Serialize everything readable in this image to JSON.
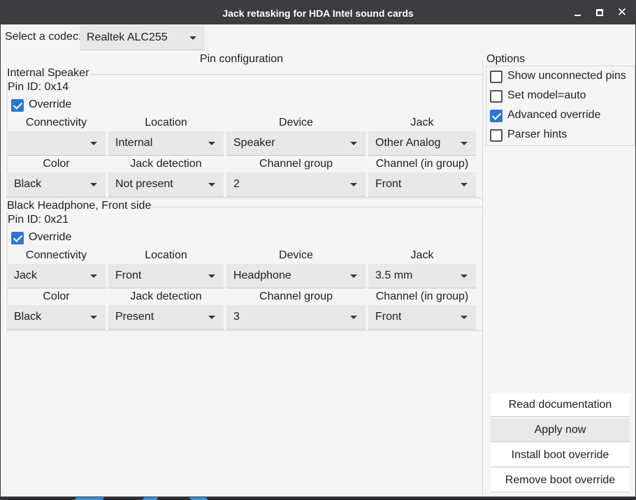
{
  "window": {
    "title": "Jack retasking for HDA Intel sound cards"
  },
  "codec": {
    "label": "Select a codec:",
    "value": "Realtek ALC255"
  },
  "pin_config": {
    "title": "Pin configuration",
    "headers_row1": [
      "Connectivity",
      "Location",
      "Device",
      "Jack"
    ],
    "headers_row2": [
      "Color",
      "Jack detection",
      "Channel group",
      "Channel (in group)"
    ],
    "pins": [
      {
        "name": "Internal Speaker",
        "pin_id": "Pin ID: 0x14",
        "override_label": "Override",
        "override": true,
        "row1": [
          "",
          "Internal",
          "Speaker",
          "Other Analog"
        ],
        "row2": [
          "Black",
          "Not present",
          "2",
          "Front"
        ]
      },
      {
        "name": "Black Headphone, Front side",
        "pin_id": "Pin ID: 0x21",
        "override_label": "Override",
        "override": true,
        "row1": [
          "Jack",
          "Front",
          "Headphone",
          "3.5 mm"
        ],
        "row2": [
          "Black",
          "Present",
          "3",
          "Front"
        ]
      }
    ]
  },
  "options": {
    "title": "Options",
    "items": [
      {
        "label": "Show unconnected pins",
        "checked": false
      },
      {
        "label": "Set model=auto",
        "checked": false
      },
      {
        "label": "Advanced override",
        "checked": true
      },
      {
        "label": "Parser hints",
        "checked": false
      }
    ]
  },
  "buttons": {
    "read_docs": "Read documentation",
    "apply_now": "Apply now",
    "install_boot": "Install boot override",
    "remove_boot": "Remove boot override"
  },
  "colors": {
    "accent": "#2a76d2",
    "titlebar": "#3c3d41",
    "window_bg": "#f5f5f5"
  }
}
